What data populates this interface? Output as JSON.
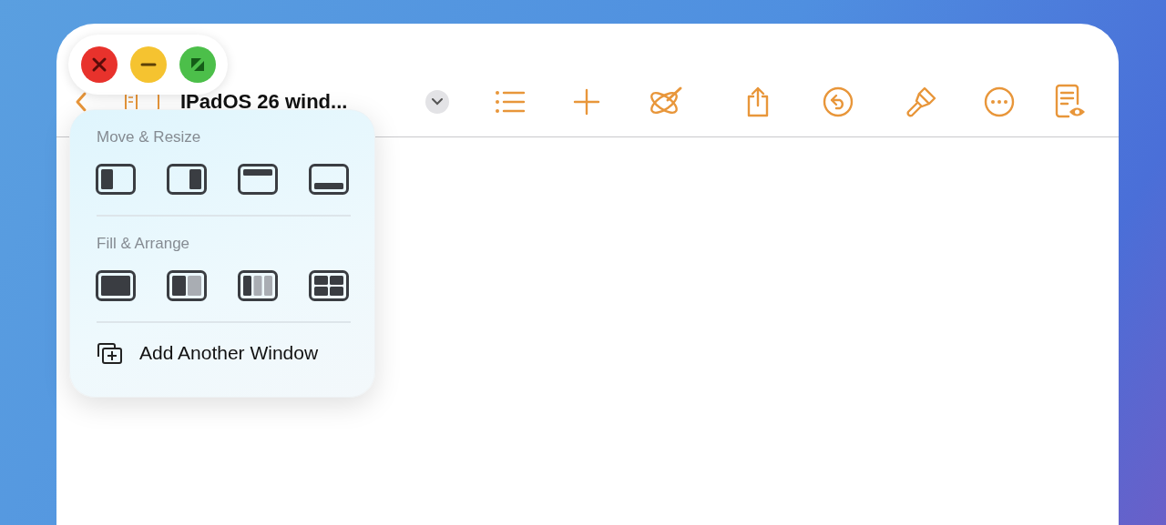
{
  "window": {
    "title": "IPadOS 26 wind..."
  },
  "popover": {
    "sections": [
      {
        "heading": "Move & Resize",
        "options": [
          {
            "kind": "left"
          },
          {
            "kind": "right"
          },
          {
            "kind": "top"
          },
          {
            "kind": "bottom"
          }
        ]
      },
      {
        "heading": "Fill & Arrange",
        "options": [
          {
            "kind": "fill"
          },
          {
            "kind": "halves"
          },
          {
            "kind": "thirds"
          },
          {
            "kind": "quarters"
          }
        ]
      }
    ],
    "action": {
      "label": "Add Another Window"
    }
  }
}
